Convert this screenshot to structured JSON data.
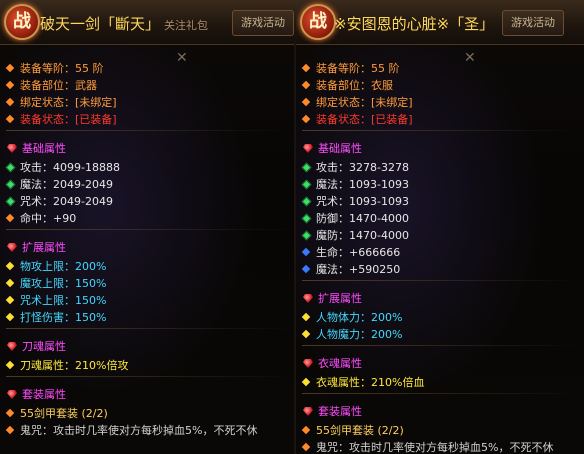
{
  "left": {
    "zhan": "战",
    "title": "破天一剑「斷天」",
    "title_sub": "关注礼包",
    "tab": "游戏活动",
    "close": "✕",
    "basic": [
      {
        "label": "装备等阶：55 阶",
        "cls": "c-orange"
      },
      {
        "label": "装备部位：武器",
        "cls": "c-orange"
      },
      {
        "label": "绑定状态：[未绑定]",
        "cls": "c-orange"
      },
      {
        "label": "装备状态：[已装备]",
        "cls": "c-red"
      }
    ],
    "base_title": "基础属性",
    "base": [
      {
        "label": "攻击：4099-18888",
        "b": "b-green"
      },
      {
        "label": "魔法：2049-2049",
        "b": "b-green"
      },
      {
        "label": "咒术：2049-2049",
        "b": "b-green"
      },
      {
        "label": "命中：+90",
        "b": "b-orange"
      }
    ],
    "ext_title": "扩展属性",
    "ext": [
      {
        "label": "物攻上限：200%"
      },
      {
        "label": "魔攻上限：150%"
      },
      {
        "label": "咒术上限：150%"
      },
      {
        "label": "打怪伤害：150%"
      }
    ],
    "soul_title": "刀魂属性",
    "soul": [
      {
        "label": "刀魂属性：210%倍攻"
      }
    ],
    "set_title": "套装属性",
    "set": [
      {
        "label": "55剑甲套装 (2/2)",
        "cls": "c-gold",
        "b": "b-orange"
      },
      {
        "label": "鬼咒：攻击时几率使对方每秒掉血5%，不死不休",
        "cls": "c-gray",
        "b": "b-orange"
      }
    ]
  },
  "right": {
    "zhan": "战",
    "title": "※安图恩的心脏※「圣」",
    "tab": "游戏活动",
    "close": "✕",
    "basic": [
      {
        "label": "装备等阶：55 阶",
        "cls": "c-orange"
      },
      {
        "label": "装备部位：衣服",
        "cls": "c-orange"
      },
      {
        "label": "绑定状态：[未绑定]",
        "cls": "c-orange"
      },
      {
        "label": "装备状态：[已装备]",
        "cls": "c-red"
      }
    ],
    "base_title": "基础属性",
    "base": [
      {
        "label": "攻击：3278-3278",
        "b": "b-green"
      },
      {
        "label": "魔法：1093-1093",
        "b": "b-green"
      },
      {
        "label": "咒术：1093-1093",
        "b": "b-green"
      },
      {
        "label": "防御：1470-4000",
        "b": "b-green"
      },
      {
        "label": "魔防：1470-4000",
        "b": "b-green"
      },
      {
        "label": "生命：+666666",
        "b": "b-blue"
      },
      {
        "label": "魔法：+590250",
        "b": "b-blue"
      }
    ],
    "ext_title": "扩展属性",
    "ext": [
      {
        "label": "人物体力：200%"
      },
      {
        "label": "人物魔力：200%"
      }
    ],
    "soul_title": "衣魂属性",
    "soul": [
      {
        "label": "衣魂属性：210%倍血"
      }
    ],
    "set_title": "套装属性",
    "set": [
      {
        "label": "55剑甲套装 (2/2)",
        "cls": "c-gold",
        "b": "b-orange"
      },
      {
        "label": "鬼咒：攻击时几率使对方每秒掉血5%，不死不休",
        "cls": "c-gray",
        "b": "b-orange"
      }
    ]
  }
}
